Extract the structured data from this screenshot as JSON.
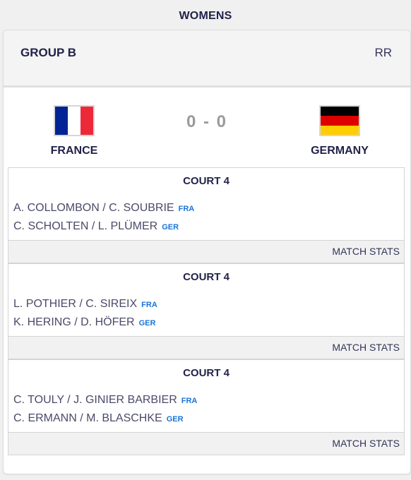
{
  "section_title": "WOMENS",
  "group": {
    "name": "GROUP B",
    "type": "RR"
  },
  "home_team": {
    "name": "FRANCE",
    "flag": "france-flag",
    "colors": [
      "#002395",
      "#ffffff",
      "#ed2939"
    ]
  },
  "away_team": {
    "name": "GERMANY",
    "flag": "germany-flag",
    "colors": [
      "#000000",
      "#dd0000",
      "#ffce00"
    ]
  },
  "score": "0 - 0",
  "matches": [
    {
      "court": "COURT 4",
      "pair_a": {
        "players": "A. COLLOMBON / C. SOUBRIE",
        "code": "FRA"
      },
      "pair_b": {
        "players": "C. SCHOLTEN / L. PLÜMER",
        "code": "GER"
      },
      "stats_label": "MATCH STATS"
    },
    {
      "court": "COURT 4",
      "pair_a": {
        "players": "L. POTHIER / C. SIREIX",
        "code": "FRA"
      },
      "pair_b": {
        "players": "K. HERING / D. HÖFER",
        "code": "GER"
      },
      "stats_label": "MATCH STATS"
    },
    {
      "court": "COURT 4",
      "pair_a": {
        "players": "C. TOULY / J. GINIER BARBIER",
        "code": "FRA"
      },
      "pair_b": {
        "players": "C. ERMANN / M. BLASCHKE",
        "code": "GER"
      },
      "stats_label": "MATCH STATS"
    }
  ],
  "accent_color": "#1a74d6"
}
